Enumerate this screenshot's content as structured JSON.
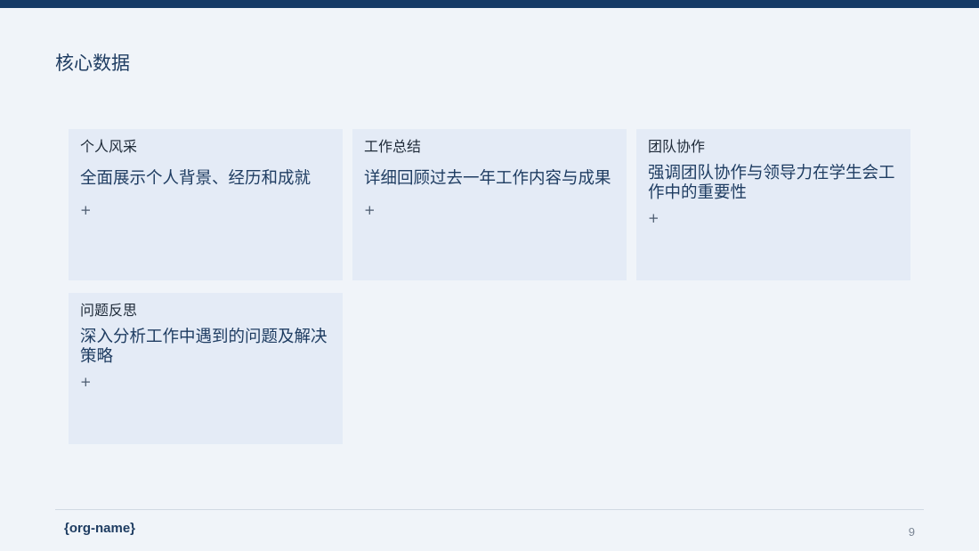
{
  "header": {
    "title": "核心数据"
  },
  "cards": [
    {
      "label": "个人风采",
      "description": "全面展示个人背景、经历和成就",
      "plus": "+"
    },
    {
      "label": "工作总结",
      "description": "详细回顾过去一年工作内容与成果",
      "plus": "+"
    },
    {
      "label": "团队协作",
      "description": "强调团队协作与领导力在学生会工作中的重要性",
      "plus": "+"
    },
    {
      "label": "问题反思",
      "description": "深入分析工作中遇到的问题及解决策略",
      "plus": "+"
    }
  ],
  "footer": {
    "org_name": "{org-name}",
    "page_number": "9"
  },
  "colors": {
    "accent": "#153a66",
    "background": "#f0f4f9",
    "card": "#e4ebf6"
  }
}
